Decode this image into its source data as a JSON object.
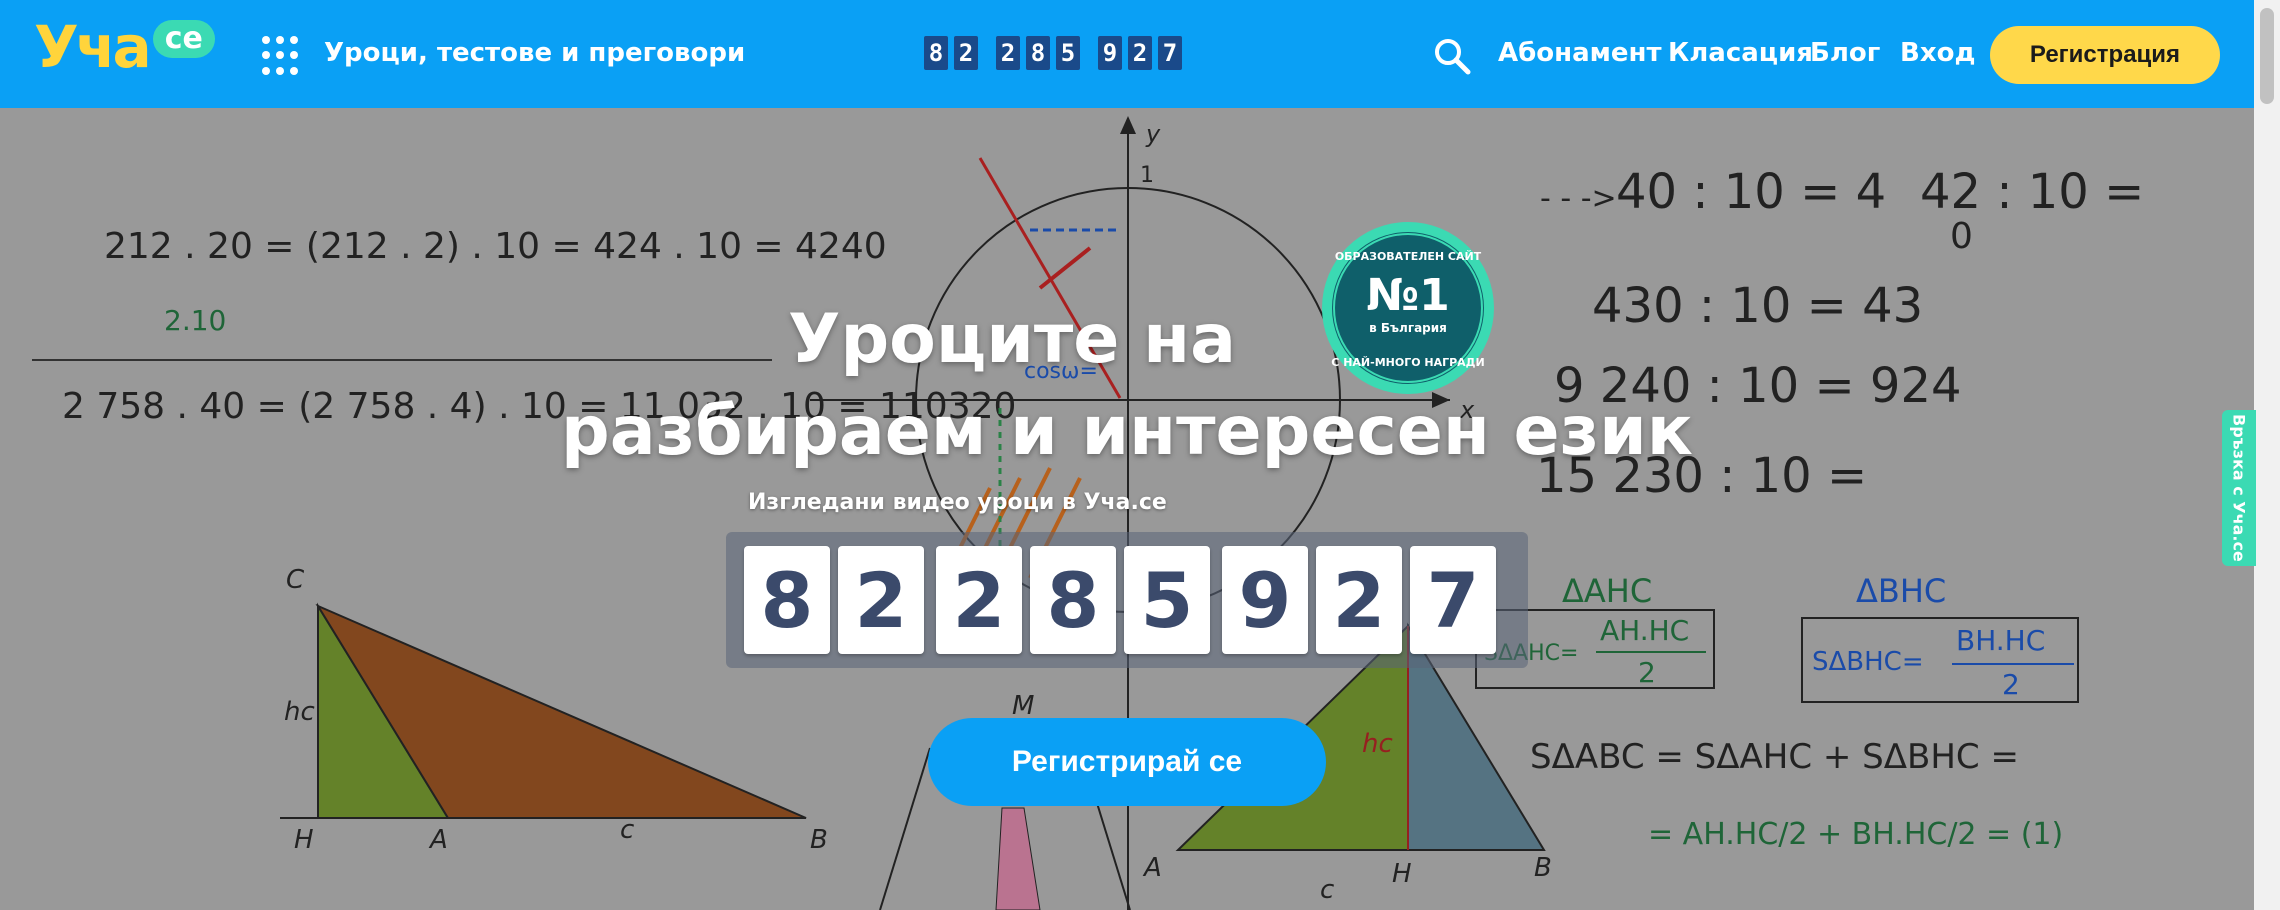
{
  "header": {
    "logo_text": "Уча",
    "logo_badge": "се",
    "lessons_label": "Уроци, тестове и преговори",
    "mini_counter": [
      "8",
      "2",
      "2",
      "8",
      "5",
      "9",
      "2",
      "7"
    ],
    "nav": {
      "subscription": "Абонамент",
      "ranking": "Класация",
      "blog": "Блог",
      "login": "Вход"
    },
    "register_label": "Регистрация"
  },
  "hero": {
    "title_line1": "Уроците на",
    "title_line2": "разбираем и интересен език",
    "counter_label": "Изгледани видео уроци в Уча.се",
    "counter_digits": [
      "8",
      "2",
      "2",
      "8",
      "5",
      "9",
      "2",
      "7"
    ],
    "cta_label": "Регистрирай се",
    "badge": {
      "top_text": "ОБРАЗОВАТЕЛЕН САЙТ",
      "number": "№1",
      "sub": "в България",
      "bottom_text": "С НАЙ-МНОГО НАГРАДИ"
    }
  },
  "board": {
    "left_eq1": "212 . 20 = (212 . 2) . 10 = 424 . 10 = 4240",
    "left_note": "2.10",
    "left_eq2": "2 758 . 40 = (2 758 . 4) . 10 = 11 032 . 10 = 110320",
    "right_eq1": "40 : 10 = 4",
    "right_eq2": "42 : 10 =",
    "right_eq2_note": "0",
    "right_eq3": "430 : 10 = 43",
    "right_eq4": "9 240 : 10 = 924",
    "right_eq5": "15 230 : 10 =",
    "axis_y": "y",
    "axis_one": "1",
    "axis_x": "x",
    "cos_label": "cosω=",
    "tri_left": {
      "C": "C",
      "H": "H",
      "A": "A",
      "B": "B",
      "hc": "hc",
      "c": "c"
    },
    "tri_right": {
      "M": "M",
      "A": "A",
      "H": "H",
      "B": "B",
      "hc": "hc",
      "c": "c"
    },
    "delta_ahc": "ΔAHC",
    "delta_bhc": "ΔBHC",
    "s_ahc_num": "AH.HC",
    "s_ahc_den": "2",
    "s_ahc_label": "SΔAHC=",
    "s_bhc_label": "SΔBHC=",
    "s_bhc_num": "BH.HC",
    "s_bhc_den": "2",
    "s_abc": "SΔABC = SΔAHC + SΔBHC =",
    "s_abc_2": "= AH.HC/2 + BH.HC/2 = (1)"
  },
  "side_tab_label": "Връзка с Уча.се",
  "colors": {
    "header_bg": "#0aa0f5",
    "register_bg": "#ffd84a",
    "logo_yellow": "#ffd43b",
    "accent_green": "#3bdab3",
    "digit_color": "#3b4a6b"
  }
}
